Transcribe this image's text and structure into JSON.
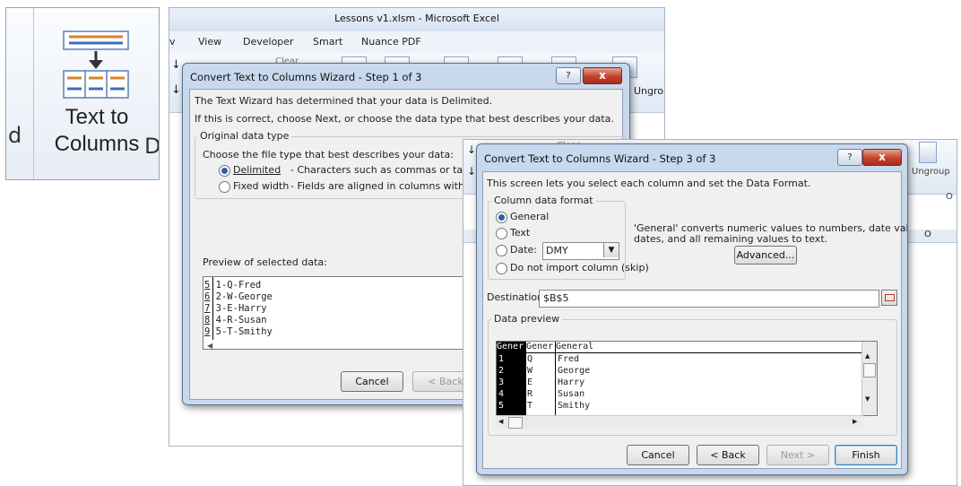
{
  "crop": {
    "label_line1": "Text to",
    "label_line2": "Columns",
    "icon": "text-to-columns-icon",
    "left_fragment": "d",
    "right_fragment": "D"
  },
  "excel_window": {
    "title": "Lessons v1.xlsm - Microsoft Excel",
    "menu": [
      "v",
      "View",
      "Developer",
      "Smart",
      "Nuance PDF"
    ],
    "ribbon_fragment": "Ungrou",
    "arrow_glyph": "↓",
    "clear_fragment": "Clear"
  },
  "dialog1": {
    "title": "Convert Text to Columns Wizard - Step 1 of 3",
    "help_label": "?",
    "close_label": "x",
    "intro": "The Text Wizard has determined that your data is Delimited.",
    "intro2": "If this is correct, choose Next, or choose the data type that best describes your data.",
    "group_title": "Original data type",
    "choose_label": "Choose the file type that best describes your data:",
    "options": [
      {
        "label": "Delimited",
        "desc": "- Characters such as commas or tabs sepa",
        "selected": true
      },
      {
        "label": "Fixed width",
        "desc": "- Fields are aligned in columns with spaces",
        "selected": false
      }
    ],
    "preview_label": "Preview of selected data:",
    "preview_rows": [
      {
        "num": "5",
        "text": "1-Q-Fred"
      },
      {
        "num": "6",
        "text": "2-W-George"
      },
      {
        "num": "7",
        "text": "3-E-Harry"
      },
      {
        "num": "8",
        "text": "4-R-Susan"
      },
      {
        "num": "9",
        "text": "5-T-Smithy"
      }
    ],
    "cancel_label": "Cancel",
    "back_label": "< Back"
  },
  "background_window2": {
    "ribbon_fragment": "Ungroup",
    "clear_fragment": "Clear",
    "column_O": "O",
    "fragment_O": "O"
  },
  "dialog3": {
    "title": "Convert Text to Columns Wizard - Step 3 of 3",
    "help_label": "?",
    "close_label": "x",
    "intro": "This screen lets you select each column and set the Data Format.",
    "group_title": "Column data format",
    "formats": [
      {
        "label": "General",
        "selected": true
      },
      {
        "label": "Text",
        "selected": false
      },
      {
        "label": "Date:",
        "selected": false
      },
      {
        "label": "Do not import column (skip)",
        "selected": false
      }
    ],
    "date_format": "DMY",
    "general_note_line1": "'General' converts numeric values to numbers, date values to",
    "general_note_line2": "dates, and all remaining values to text.",
    "advanced_label": "Advanced...",
    "destination_label": "Destination:",
    "destination_value": "$B$5",
    "data_preview_title": "Data preview",
    "preview_headers": [
      "Gener",
      "Gener",
      "General"
    ],
    "preview_rows": [
      {
        "c1": "1",
        "c2": "Q",
        "c3": "Fred"
      },
      {
        "c1": "2",
        "c2": "W",
        "c3": "George"
      },
      {
        "c1": "3",
        "c2": "E",
        "c3": "Harry"
      },
      {
        "c1": "4",
        "c2": "R",
        "c3": "Susan"
      },
      {
        "c1": "5",
        "c2": "T",
        "c3": "Smithy"
      }
    ],
    "cancel_label": "Cancel",
    "back_label": "< Back",
    "next_label": "Next >",
    "finish_label": "Finish"
  }
}
